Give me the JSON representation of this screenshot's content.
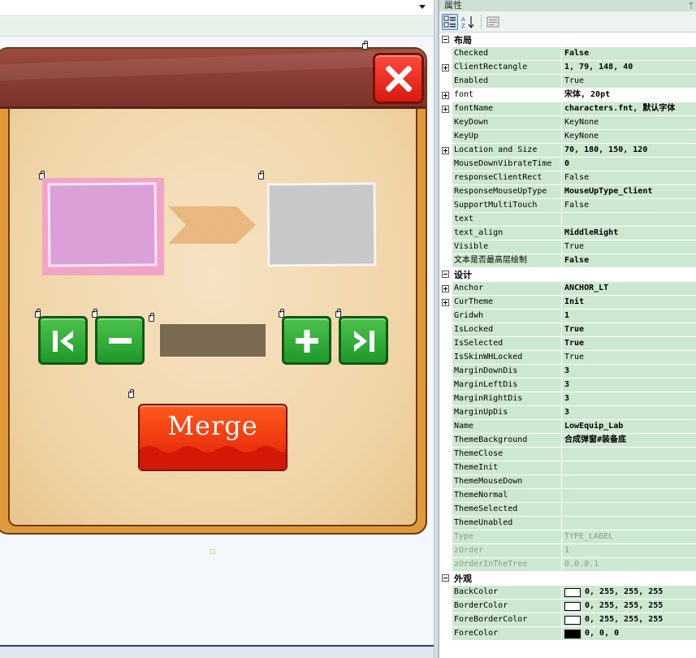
{
  "panel": {
    "title": "属性",
    "pin_glyph": "ᛘ"
  },
  "dialog": {
    "merge_label": "Merge",
    "close_icon": "close-x-icon"
  },
  "categories": [
    {
      "label": "布局",
      "rows": [
        {
          "name": "Checked",
          "value": "False",
          "bold": true
        },
        {
          "name": "ClientRectangle",
          "value": "1, 79, 148, 40",
          "bold": true,
          "expandable": true
        },
        {
          "name": "Enabled",
          "value": "True"
        },
        {
          "name": "font",
          "value": "宋体, 20pt",
          "bold": true,
          "expandable": true,
          "selected": true
        },
        {
          "name": "fontName",
          "value": "characters.fnt, 默认字体",
          "bold": true,
          "expandable": true
        },
        {
          "name": "KeyDown",
          "value": "KeyNone"
        },
        {
          "name": "KeyUp",
          "value": "KeyNone"
        },
        {
          "name": "Location and Size",
          "value": "70, 180, 150, 120",
          "bold": true,
          "expandable": true
        },
        {
          "name": "MouseDownVibrateTime",
          "value": "0",
          "bold": true
        },
        {
          "name": "responseClientRect",
          "value": "False"
        },
        {
          "name": "ResponseMouseUpType",
          "value": "MouseUpType_Client",
          "bold": true
        },
        {
          "name": "SupportMultiTouch",
          "value": "False"
        },
        {
          "name": "text",
          "value": ""
        },
        {
          "name": "text_align",
          "value": "MiddleRight",
          "bold": true
        },
        {
          "name": "Visible",
          "value": "True"
        },
        {
          "name": "文本是否最高层绘制",
          "value": "False",
          "bold": true
        }
      ]
    },
    {
      "label": "设计",
      "rows": [
        {
          "name": "Anchor",
          "value": "ANCHOR_LT",
          "bold": true,
          "expandable": true
        },
        {
          "name": "CurTheme",
          "value": "Init",
          "bold": true,
          "expandable": true
        },
        {
          "name": "Gridwh",
          "value": "1",
          "bold": true
        },
        {
          "name": "IsLocked",
          "value": "True",
          "bold": true
        },
        {
          "name": "IsSelected",
          "value": "True",
          "bold": true
        },
        {
          "name": "IsSkinWHLocked",
          "value": "True"
        },
        {
          "name": "MarginDownDis",
          "value": "3",
          "bold": true
        },
        {
          "name": "MarginLeftDis",
          "value": "3",
          "bold": true
        },
        {
          "name": "MarginRightDis",
          "value": "3",
          "bold": true
        },
        {
          "name": "MarginUpDis",
          "value": "3",
          "bold": true
        },
        {
          "name": "Name",
          "value": "LowEquip_Lab",
          "bold": true
        },
        {
          "name": "ThemeBackground",
          "value": "合成弹窗#装备底",
          "bold": true
        },
        {
          "name": "ThemeClose",
          "value": ""
        },
        {
          "name": "ThemeInit",
          "value": ""
        },
        {
          "name": "ThemeMouseDown",
          "value": ""
        },
        {
          "name": "ThemeNormal",
          "value": ""
        },
        {
          "name": "ThemeSelected",
          "value": ""
        },
        {
          "name": "ThemeUnabled",
          "value": ""
        },
        {
          "name": "Type",
          "value": "TYPE_LABEL",
          "readonly": true
        },
        {
          "name": "zOrder",
          "value": "1",
          "readonly": true
        },
        {
          "name": "zOrderInTheTree",
          "value": "0.0.0.1",
          "readonly": true
        }
      ]
    },
    {
      "label": "外观",
      "rows": [
        {
          "name": "BackColor",
          "value": "0, 255, 255, 255",
          "swatch": "#ffffff"
        },
        {
          "name": "BorderColor",
          "value": "0, 255, 255, 255",
          "swatch": "#ffffff"
        },
        {
          "name": "ForeBorderColor",
          "value": "0, 255, 255, 255",
          "swatch": "#ffffff"
        },
        {
          "name": "ForeColor",
          "value": "0, 0, 0",
          "swatch": "#000000"
        }
      ]
    }
  ]
}
